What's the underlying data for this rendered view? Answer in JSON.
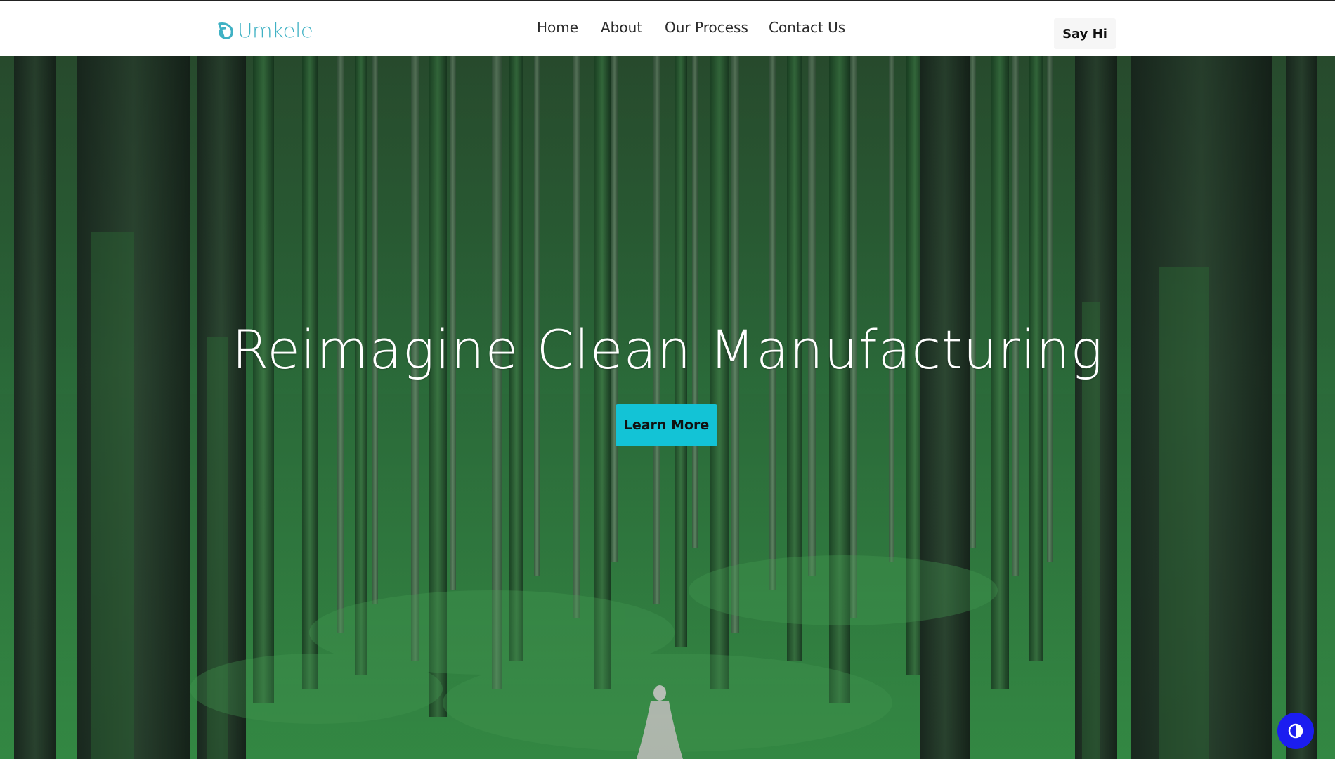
{
  "header": {
    "logo_text": "Umkele",
    "nav": [
      {
        "label": "Home"
      },
      {
        "label": "About"
      },
      {
        "label": "Our Process"
      },
      {
        "label": "Contact Us"
      }
    ],
    "cta_label": "Say Hi"
  },
  "hero": {
    "title": "Reimagine Clean Manufacturing",
    "button_label": "Learn More",
    "background": "forest-photo"
  },
  "accessibility": {
    "icon": "contrast-icon"
  },
  "colors": {
    "brand": "#3fb1c4",
    "button": "#13c3d6",
    "accessibility": "#1b1df0"
  }
}
